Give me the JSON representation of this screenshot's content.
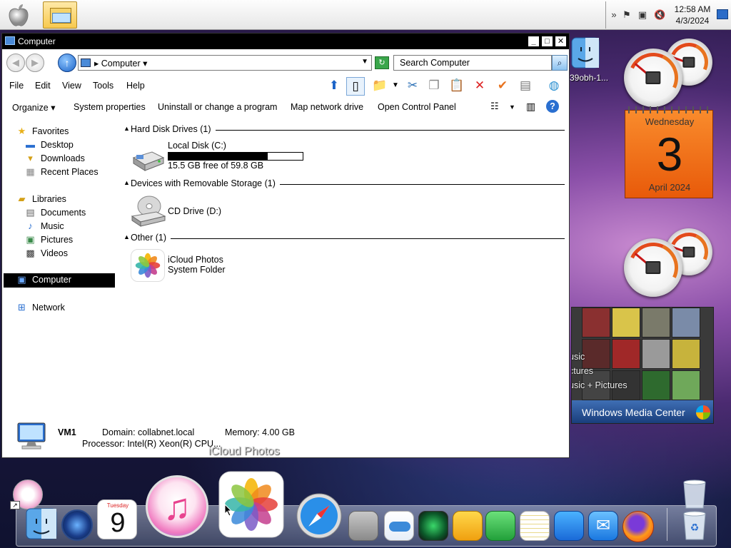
{
  "menubar": {
    "clock_time": "12:58 AM",
    "clock_date": "4/3/2024"
  },
  "window": {
    "title": "Computer",
    "address": {
      "crumb": "Computer"
    },
    "search_placeholder": "Search Computer",
    "menu": [
      "File",
      "Edit",
      "View",
      "Tools",
      "Help"
    ],
    "commands": [
      "Organize",
      "System properties",
      "Uninstall or change a program",
      "Map network drive",
      "Open Control Panel"
    ],
    "nav": {
      "favorites": "Favorites",
      "desktop": "Desktop",
      "downloads": "Downloads",
      "recent": "Recent Places",
      "libraries": "Libraries",
      "documents": "Documents",
      "music": "Music",
      "pictures": "Pictures",
      "videos": "Videos",
      "computer": "Computer",
      "network": "Network"
    },
    "groups": {
      "hdd": "Hard Disk Drives (1)",
      "removable": "Devices with Removable Storage (1)",
      "other": "Other (1)"
    },
    "items": {
      "local_disk": {
        "name": "Local Disk (C:)",
        "free": "15.5 GB free of 59.8 GB",
        "used_fraction": 0.74
      },
      "cd_drive": {
        "name": "CD Drive (D:)"
      },
      "icloud": {
        "name": "iCloud Photos",
        "type": "System Folder"
      }
    },
    "details": {
      "name": "VM1",
      "domain": "Domain: collabnet.local",
      "memory": "Memory: 4.00 GB",
      "processor": "Processor: Intel(R) Xeon(R) CPU..."
    }
  },
  "tooltip": "iCloud Photos",
  "desktop": {
    "finder_label": "39obh-1...",
    "calendar": {
      "weekday": "Wednesday",
      "day": "3",
      "month": "April 2024"
    },
    "media_center": {
      "title": "Windows Media Center",
      "labels": [
        "usic",
        "ctures",
        "usic + Pictures"
      ]
    }
  },
  "dock": {
    "calendar_day": "9",
    "calendar_weekday": "Tuesday"
  },
  "icons": {
    "apple": "apple-logo-icon",
    "explorer": "windows-explorer-icon",
    "tray": [
      "show-hidden-icons-icon",
      "action-center-flag-icon",
      "network-icon",
      "volume-muted-icon",
      "show-desktop-icon"
    ]
  }
}
